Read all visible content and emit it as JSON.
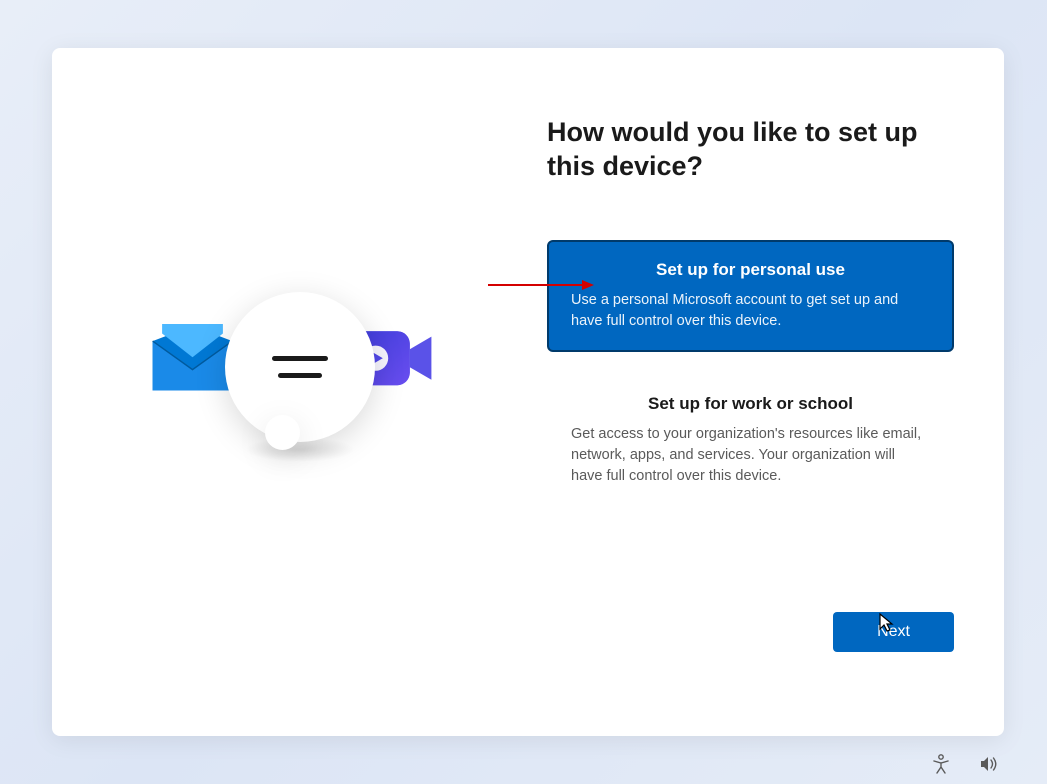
{
  "page": {
    "title": "How would you like to set up this device?"
  },
  "options": {
    "personal": {
      "title": "Set up for personal use",
      "description": "Use a personal Microsoft account to get set up and have full control over this device."
    },
    "work": {
      "title": "Set up for work or school",
      "description": "Get access to your organization's resources like email, network, apps, and services. Your organization will have full control over this device."
    }
  },
  "buttons": {
    "next": "Next"
  },
  "colors": {
    "accent": "#0067c0",
    "accent_border": "#003a6b"
  }
}
